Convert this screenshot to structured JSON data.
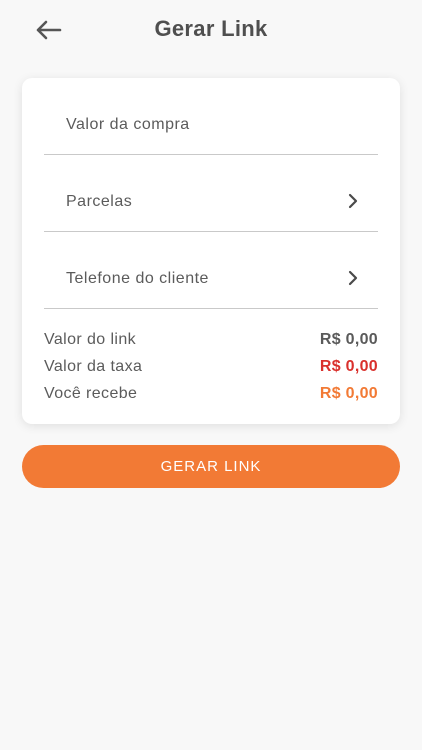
{
  "header": {
    "title": "Gerar Link",
    "back_icon": "arrow-left-icon"
  },
  "form": {
    "purchase_value_placeholder": "Valor da compra",
    "installments_label": "Parcelas",
    "customer_phone_label": "Telefone do cliente",
    "chevron_icon": "chevron-right-icon"
  },
  "summary": {
    "link_value_label": "Valor do link",
    "link_value": "R$ 0,00",
    "fee_value_label": "Valor da taxa",
    "fee_value": "R$ 0,00",
    "receive_label": "Você recebe",
    "receive_value": "R$ 0,00"
  },
  "actions": {
    "generate_label": "GERAR LINK"
  },
  "colors": {
    "accent": "#f27a35",
    "fee_red": "#d9302c",
    "neutral_value": "#5a5a5a",
    "receive_orange": "#f27a35"
  }
}
